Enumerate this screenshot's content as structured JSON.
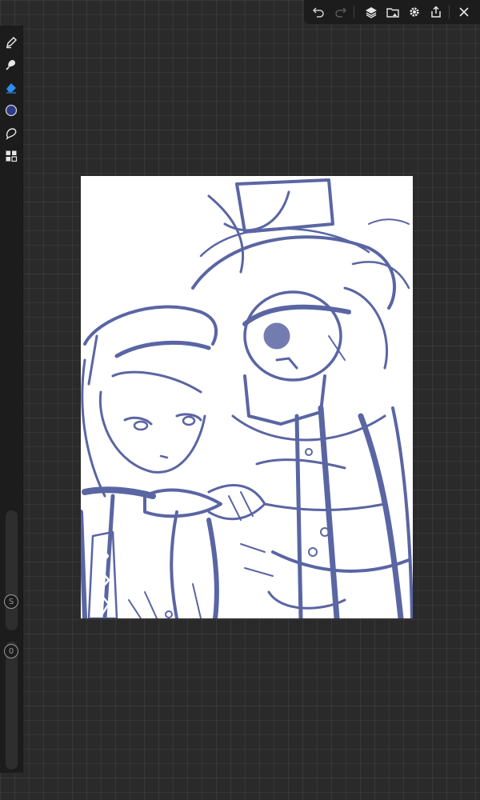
{
  "app": {
    "accent_color": "#2d8cf0",
    "ink_color": "#2c3b8a"
  },
  "top_toolbar": {
    "buttons": [
      {
        "name": "undo",
        "icon": "undo-icon",
        "enabled": true
      },
      {
        "name": "redo",
        "icon": "redo-icon",
        "enabled": false
      },
      {
        "name": "layers",
        "icon": "layers-icon",
        "enabled": true
      },
      {
        "name": "gallery",
        "icon": "folder-image-icon",
        "enabled": true
      },
      {
        "name": "settings",
        "icon": "gear-icon",
        "enabled": true
      },
      {
        "name": "share",
        "icon": "share-icon",
        "enabled": true
      },
      {
        "name": "close",
        "icon": "close-icon",
        "enabled": true
      }
    ]
  },
  "left_toolbar": {
    "tools": [
      {
        "name": "pen",
        "icon": "pen-icon",
        "active": false
      },
      {
        "name": "smudge",
        "icon": "smudge-icon",
        "active": false
      },
      {
        "name": "eraser",
        "icon": "eraser-icon",
        "active": true
      },
      {
        "name": "color",
        "icon": "color-swatch-icon",
        "color": "#2c3b8a"
      },
      {
        "name": "lasso",
        "icon": "lasso-icon",
        "active": false
      },
      {
        "name": "adjustments",
        "icon": "grid-tiles-icon",
        "active": false
      }
    ],
    "size_slider": {
      "label": "S"
    },
    "opacity_slider": {
      "label": "0"
    }
  },
  "canvas": {
    "background": "#ffffff",
    "content": "sketch-artwork"
  }
}
